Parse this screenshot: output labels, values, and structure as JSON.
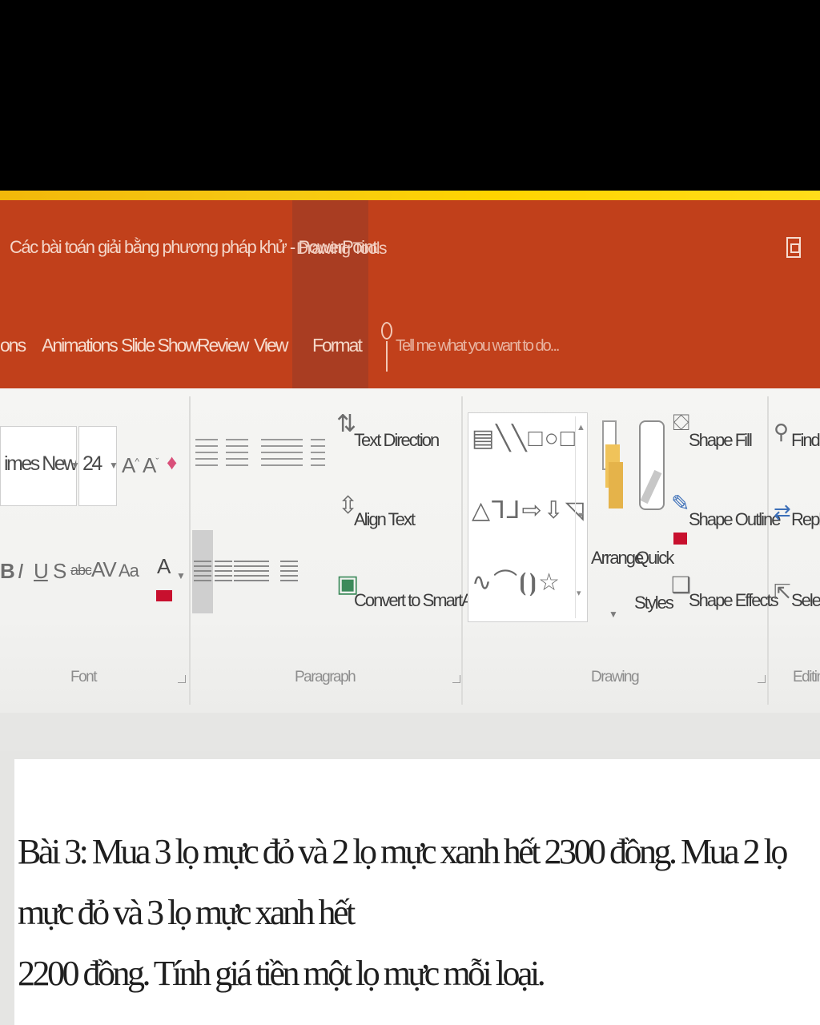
{
  "window": {
    "title": "Các bài toán giải bằng phương pháp khử - PowerPoint",
    "context_tab_group": "Drawing Tools"
  },
  "tabs": [
    {
      "label": "ons"
    },
    {
      "label": "Animations"
    },
    {
      "label": "Slide Show"
    },
    {
      "label": "Review"
    },
    {
      "label": "View"
    },
    {
      "label": "Format"
    }
  ],
  "tell_me": {
    "placeholder": "Tell me what you want to do..."
  },
  "ribbon": {
    "font": {
      "font_name": "imes New Ror",
      "font_size": "24",
      "group_label": "Font"
    },
    "paragraph": {
      "text_direction": "Text Direction",
      "align_text": "Align Text",
      "convert_smartart": "Convert to SmartArt",
      "group_label": "Paragraph"
    },
    "drawing": {
      "arrange": "Arrange",
      "quick": "Quick",
      "styles": "Styles",
      "shape_fill": "Shape Fill",
      "shape_outline": "Shape Outline",
      "shape_effects": "Shape Effects",
      "group_label": "Drawing"
    },
    "editing": {
      "find": "Find",
      "replace": "Replac",
      "select": "Select",
      "group_label": "Editin"
    }
  },
  "slide": {
    "line1": "Bài 3: Mua 3 lọ mực đỏ và 2 lọ mực xanh hết 2300 đồng. Mua 2 lọ mực đỏ và 3 lọ mực xanh hết",
    "line2": "2200 đồng. Tính giá tiền một lọ mực mỗi loại."
  },
  "colors": {
    "ribbon_accent": "#c1401b",
    "font_color": "#c8102e",
    "outline_color": "#c8102e"
  }
}
